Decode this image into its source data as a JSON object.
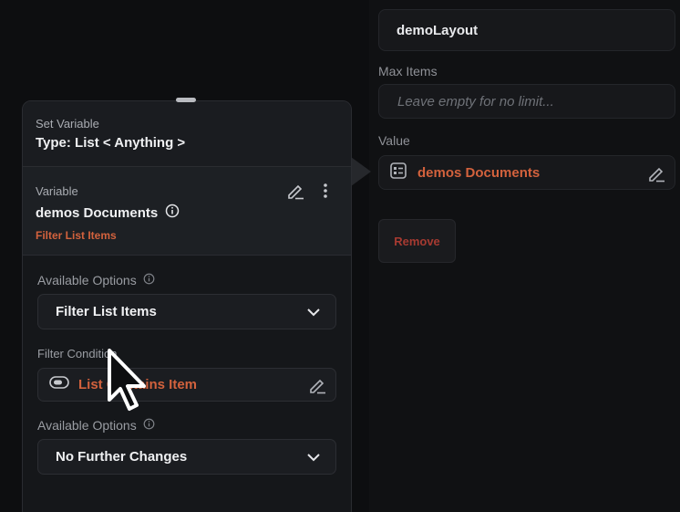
{
  "right_panel": {
    "layout_name": "demoLayout",
    "max_items_label": "Max Items",
    "max_items_placeholder": "Leave empty for no limit...",
    "value_label": "Value",
    "value_text": "demos Documents",
    "remove_label": "Remove"
  },
  "card": {
    "header_small": "Set Variable",
    "header_type": "Type: List < Anything >",
    "variable_label": "Variable",
    "variable_name": "demos Documents",
    "variable_sub": "Filter List Items",
    "available_options_label_1": "Available Options",
    "available_options_value_1": "Filter List Items",
    "filter_condition_label": "Filter Condition",
    "filter_condition_value": "List Contains Item",
    "available_options_label_2": "Available Options",
    "available_options_value_2": "No Further Changes"
  },
  "colors": {
    "accent_orange": "#d3623d",
    "remove_red": "#a63a31",
    "background": "#0d0e10"
  }
}
